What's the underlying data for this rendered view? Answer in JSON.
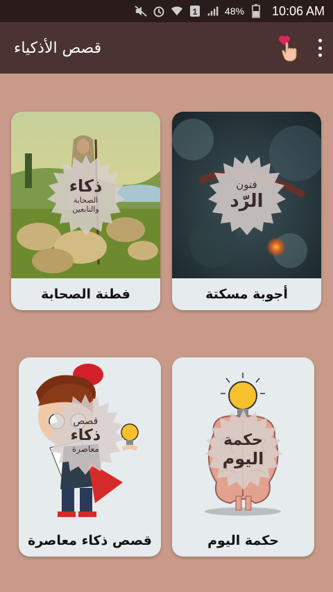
{
  "status_bar": {
    "battery": "48%",
    "time": "10:06 AM"
  },
  "app_bar": {
    "title": "قصص الأذكياء",
    "favorite_icon": "heart-hand-icon",
    "menu_icon": "overflow-menu-icon"
  },
  "cards": [
    {
      "label": "أجوبة مسكتة",
      "badge_top": "فنون",
      "badge_main": "الرّد",
      "badge_bottom": ""
    },
    {
      "label": "فطنة الصحابة",
      "badge_top": "",
      "badge_main": "ذكاء",
      "badge_bottom": "الصحابة والتابعين"
    },
    {
      "label": "حكمة اليوم",
      "badge_top": "حكمة",
      "badge_main": "اليوم",
      "badge_bottom": ""
    },
    {
      "label": "قصص ذكاء معاصرة",
      "badge_top": "قصص",
      "badge_main": "ذكاء",
      "badge_bottom": "معاصرة"
    }
  ],
  "colors": {
    "background": "#c99a89",
    "app_bar": "#4a3330",
    "card": "#e6ebed",
    "status_bar": "#2a1c1a"
  }
}
